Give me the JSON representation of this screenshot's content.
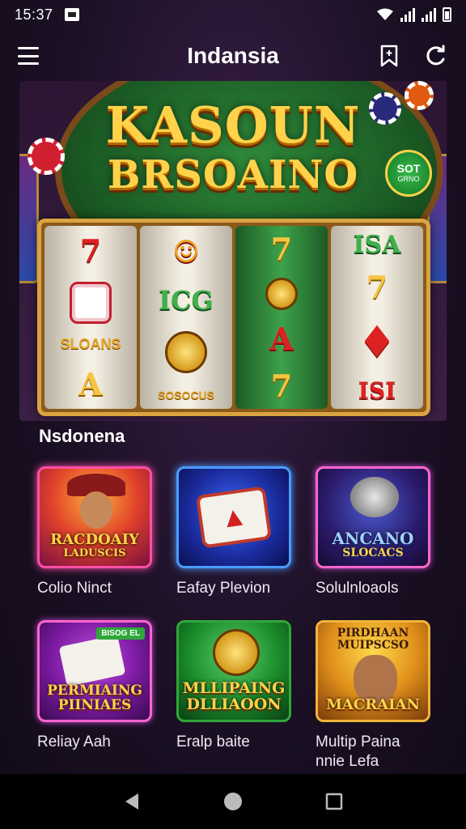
{
  "status_bar": {
    "time": "15:37"
  },
  "app_bar": {
    "title": "Indansia"
  },
  "hero": {
    "title_line1": "KASOUN",
    "title_line2": "BRSOAINO",
    "badge_line1": "SOT",
    "badge_line2": "GRNO",
    "reels": [
      [
        "7",
        "◆",
        "SLOANS",
        "A"
      ],
      [
        "☺",
        "ICG",
        "●",
        "SOSOCUS"
      ],
      [
        "7",
        "●",
        "A",
        "7"
      ],
      [
        "ISA",
        "7",
        "♦",
        "ISI"
      ]
    ]
  },
  "section": {
    "title": "Nsdonena"
  },
  "games": [
    {
      "thumb_text": [
        "RACDOAIY",
        "LADUSCIS"
      ],
      "label": "Colio Ninct",
      "label2": "",
      "theme": "pink"
    },
    {
      "thumb_text": [],
      "label": "Eafay Plevion",
      "label2": "",
      "theme": "blue"
    },
    {
      "thumb_text": [
        "ANCANO",
        "SLOCACS"
      ],
      "label": "Solulnloaols",
      "label2": "",
      "theme": "purple"
    },
    {
      "thumb_text": [
        "PERMIAING",
        "PIINIAES"
      ],
      "label": "Reliay Aah",
      "label2": "",
      "theme": "violet",
      "tag": "BISOG EL"
    },
    {
      "thumb_text": [
        "MLLIPAING",
        "DLLIAOON"
      ],
      "label": "Eralp baite",
      "label2": "",
      "theme": "green"
    },
    {
      "thumb_text": [
        "PIRDHAAN",
        "MUIPSCSO",
        "MACRAIAN"
      ],
      "label": "Multip Paina",
      "label2": "nnie Lefa",
      "theme": "gold"
    }
  ],
  "colors": {
    "accent": "#ffd24a",
    "background": "#1a0f22",
    "felt": "#2f8a3a"
  },
  "icons": {
    "menu": "hamburger-icon",
    "action1": "bookmark-icon",
    "action2": "refresh-icon",
    "nav_back": "back-triangle-icon",
    "nav_home": "home-circle-icon",
    "nav_recent": "recent-square-icon"
  }
}
